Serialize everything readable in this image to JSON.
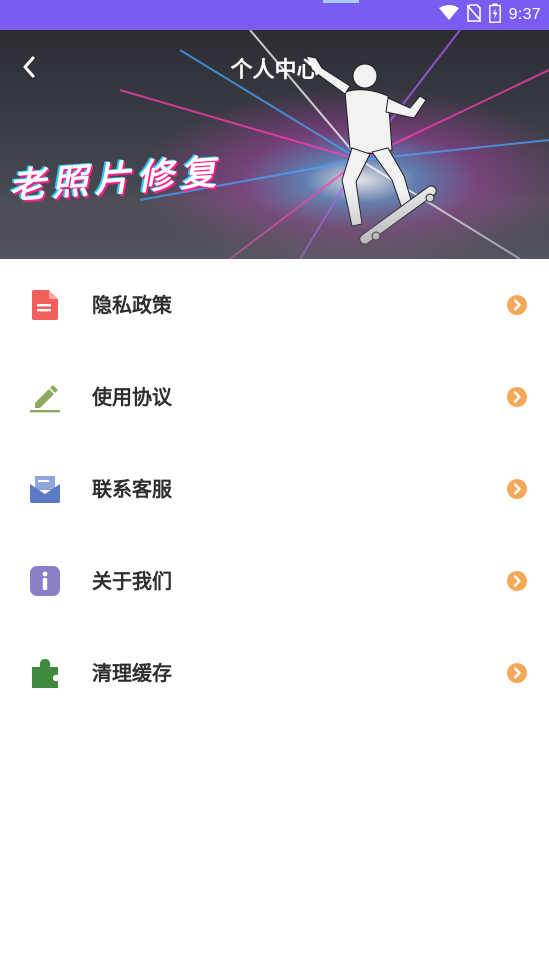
{
  "status_bar": {
    "time": "9:37",
    "icons": [
      "wifi-icon",
      "no-sim-icon",
      "battery-charging-icon"
    ],
    "color": "#7b5cf0"
  },
  "header": {
    "back_icon": "chevron-left-icon",
    "title": "个人中心"
  },
  "banner": {
    "slogan": "老照片修复"
  },
  "menu": {
    "arrow_color": "#f5a858",
    "items": [
      {
        "label": "隐私政策",
        "icon": "document-icon",
        "icon_color": "#f25f5c"
      },
      {
        "label": "使用协议",
        "icon": "pencil-icon",
        "icon_color": "#8bab63"
      },
      {
        "label": "联系客服",
        "icon": "mail-icon",
        "icon_color": "#5b79c4"
      },
      {
        "label": "关于我们",
        "icon": "info-icon",
        "icon_color": "#8d7fc7"
      },
      {
        "label": "清理缓存",
        "icon": "puzzle-icon",
        "icon_color": "#3f8a3f"
      }
    ]
  }
}
